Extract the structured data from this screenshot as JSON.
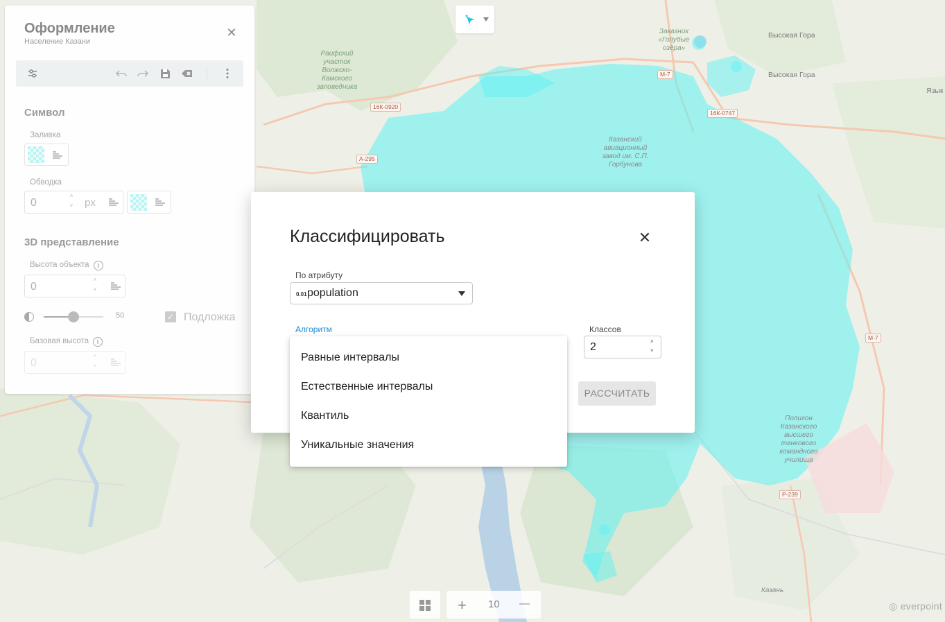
{
  "map": {
    "labels": {
      "raifa": "Раифский участок Волжско-Камского заповедника",
      "zakaznik": "Заказник «Голубые озёра»",
      "vysokaya_gora_1": "Высокая Гора",
      "vysokaya_gora_2": "Высокая Гора",
      "yaszyk": "Языки",
      "aviazavod": "Казанский авиационный завод им. С.П. Горбунова",
      "poligon": "Полигон Казанского высшего танкового командного училища",
      "kazan": "Казань"
    },
    "roads": {
      "r1": "16К-0920",
      "r2": "А-295",
      "r3": "М-7",
      "r4": "16К-0747",
      "r5": "М-7",
      "r6": "Р-239"
    },
    "overlay_color": "#5ef2f2"
  },
  "panel": {
    "title": "Оформление",
    "subtitle": "Население Казани",
    "symbol_section": "Символ",
    "fill_label": "Заливка",
    "stroke_label": "Обводка",
    "stroke_value": "0",
    "stroke_unit": "px",
    "view3d_section": "3D представление",
    "height_label": "Высота объекта",
    "height_value": "0",
    "opacity_value": "50",
    "opacity_fraction": 0.5,
    "underlay_label": "Подложка",
    "base_height_label": "Базовая высота",
    "base_height_value": "0"
  },
  "zoom": {
    "plus": "+",
    "level": "10",
    "minus": "—"
  },
  "modal": {
    "title": "Классифицировать",
    "attribute_label": "По атрибуту",
    "attribute_type": "0.01",
    "attribute_value": "population",
    "algorithm_label": "Алгоритм",
    "classes_label": "Классов",
    "classes_value": "2",
    "calculate_button": "РАССЧИТАТЬ"
  },
  "dropdown": {
    "options": [
      "Равные интервалы",
      "Естественные интервалы",
      "Квантиль",
      "Уникальные значения"
    ]
  },
  "branding": {
    "logo_text": "everpoint"
  }
}
